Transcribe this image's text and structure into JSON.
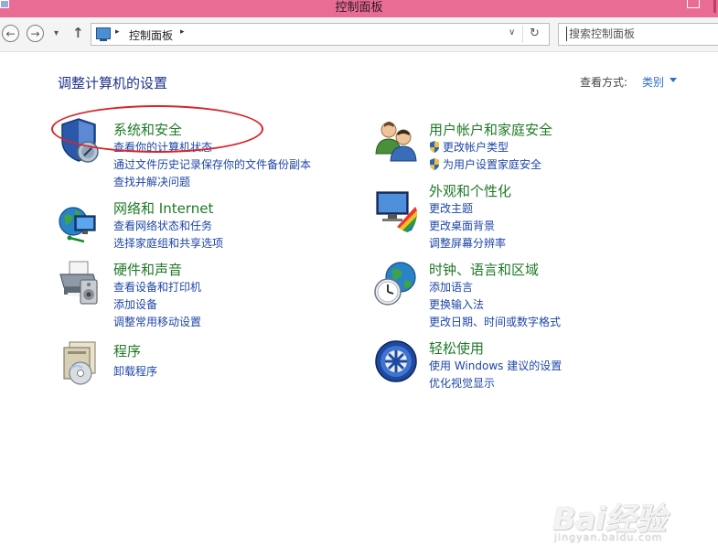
{
  "window": {
    "title": "控制面板"
  },
  "nav": {
    "back_glyph": "←",
    "forward_glyph": "→",
    "history_glyph": "▾",
    "up_glyph": "↑",
    "breadcrumb": "控制面板",
    "breadcrumb_sep": "▸",
    "address_dropdown_glyph": "∨",
    "refresh_glyph": "↻",
    "search_placeholder": "搜索控制面板"
  },
  "page": {
    "heading": "调整计算机的设置",
    "view_by_label": "查看方式:",
    "view_by_value": "类别"
  },
  "categories": [
    {
      "title": "系统和安全",
      "icon": "shield-icon",
      "links": [
        "查看你的计算机状态",
        "通过文件历史记录保存你的文件备份副本",
        "查找并解决问题"
      ]
    },
    {
      "title": "网络和 Internet",
      "icon": "network-globe-icon",
      "links": [
        "查看网络状态和任务",
        "选择家庭组和共享选项"
      ]
    },
    {
      "title": "硬件和声音",
      "icon": "printer-icon",
      "links": [
        "查看设备和打印机",
        "添加设备",
        "调整常用移动设置"
      ]
    },
    {
      "title": "程序",
      "icon": "programs-icon",
      "links": [
        "卸载程序"
      ]
    },
    {
      "title": "用户帐户和家庭安全",
      "icon": "users-icon",
      "links": [
        "更改帐户类型",
        "为用户设置家庭安全"
      ]
    },
    {
      "title": "外观和个性化",
      "icon": "appearance-icon",
      "links": [
        "更改主题",
        "更改桌面背景",
        "调整屏幕分辨率"
      ]
    },
    {
      "title": "时钟、语言和区域",
      "icon": "clock-globe-icon",
      "links": [
        "添加语言",
        "更换输入法",
        "更改日期、时间或数字格式"
      ]
    },
    {
      "title": "轻松使用",
      "icon": "ease-of-access-icon",
      "links": [
        "使用 Windows 建议的设置",
        "优化视觉显示"
      ]
    }
  ],
  "watermark": {
    "text": "Bai经验",
    "sub": "jingyan.baidu.com"
  },
  "colors": {
    "titlebar": "#e96c95",
    "category_title": "#1f7a26",
    "link": "#1e46a8",
    "heading": "#1e3287",
    "annotation": "#d8242a"
  }
}
